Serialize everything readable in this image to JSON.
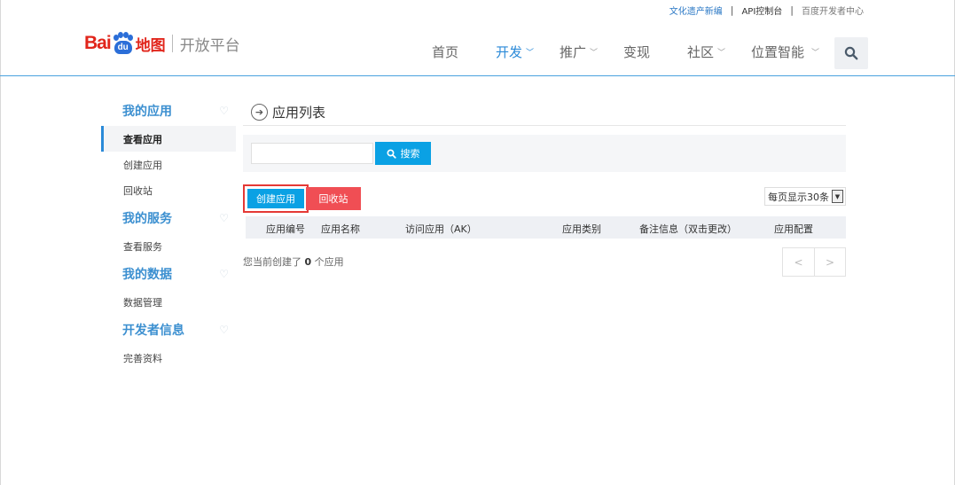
{
  "top_links": {
    "link1": "文化遗产新编",
    "sep1": "|",
    "link2": "API控制台",
    "sep2": "|",
    "link3": "百度开发者中心"
  },
  "logo": {
    "bai": "Bai",
    "du": "du",
    "map": "地图",
    "subtitle": "开放平台"
  },
  "nav": [
    {
      "label": "首页",
      "chevron": ""
    },
    {
      "label": "开发",
      "chevron": "⌄"
    },
    {
      "label": "推广",
      "chevron": "⌄"
    },
    {
      "label": "变现",
      "chevron": ""
    },
    {
      "label": "社区",
      "chevron": "⌄"
    },
    {
      "label": "位置智能",
      "chevron": "⌄"
    }
  ],
  "sidebar": {
    "group1": {
      "title": "我的应用",
      "items": [
        "查看应用",
        "创建应用",
        "回收站"
      ]
    },
    "group2": {
      "title": "我的服务",
      "items": [
        "查看服务"
      ]
    },
    "group3": {
      "title": "我的数据",
      "items": [
        "数据管理"
      ]
    },
    "group4": {
      "title": "开发者信息",
      "items": [
        "完善资料"
      ]
    }
  },
  "main": {
    "title": "应用列表",
    "search": {
      "value": "",
      "placeholder": "",
      "button": "搜索"
    },
    "create_button": "创建应用",
    "recycle_button": "回收站",
    "page_size": "每页显示30条",
    "columns": [
      "应用编号",
      "应用名称",
      "访问应用（AK）",
      "应用类别",
      "备注信息（双击更改）",
      "应用配置"
    ],
    "summary_prefix": "您当前创建了",
    "summary_count": "0",
    "summary_suffix": "个应用",
    "pager": {
      "prev": "<",
      "next": ">"
    }
  },
  "colors": {
    "accent": "#2b8ad8",
    "button_blue": "#0aa1e4",
    "button_red": "#f04e54",
    "highlight_border": "#e53935",
    "logo_red": "#e1251b",
    "logo_blue": "#2b6ed8"
  }
}
